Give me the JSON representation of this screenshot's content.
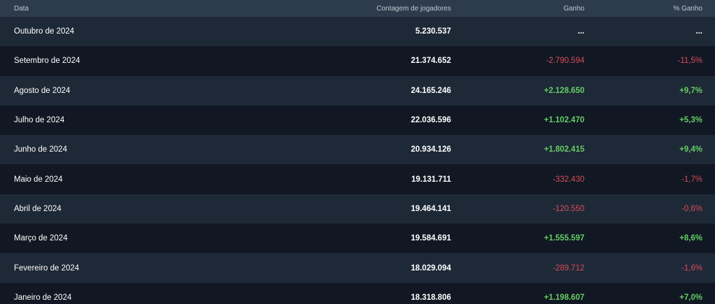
{
  "table": {
    "headers": {
      "date": "Data",
      "count": "Contagem de jogadores",
      "gain": "Ganho",
      "pct": "% Ganho"
    },
    "colors": {
      "header_bg": "#2d3c4d",
      "row_odd": "#1e2937",
      "row_even": "#111823",
      "positive": "#66cc66",
      "negative": "#d94b5a"
    },
    "rows": [
      {
        "date": "Outubro de 2024",
        "count": "5.230.537",
        "gain": "...",
        "pct": "...",
        "trend": "neutral"
      },
      {
        "date": "Setembro de 2024",
        "count": "21.374.652",
        "gain": "-2.790.594",
        "pct": "-11,5%",
        "trend": "neg"
      },
      {
        "date": "Agosto de 2024",
        "count": "24.165.246",
        "gain": "+2.128.650",
        "pct": "+9,7%",
        "trend": "pos"
      },
      {
        "date": "Julho de 2024",
        "count": "22.036.596",
        "gain": "+1.102.470",
        "pct": "+5,3%",
        "trend": "pos"
      },
      {
        "date": "Junho de 2024",
        "count": "20.934.126",
        "gain": "+1.802.415",
        "pct": "+9,4%",
        "trend": "pos"
      },
      {
        "date": "Maio de 2024",
        "count": "19.131.711",
        "gain": "-332.430",
        "pct": "-1,7%",
        "trend": "neg"
      },
      {
        "date": "Abril de 2024",
        "count": "19.464.141",
        "gain": "-120.550",
        "pct": "-0,6%",
        "trend": "neg"
      },
      {
        "date": "Março de 2024",
        "count": "19.584.691",
        "gain": "+1.555.597",
        "pct": "+8,6%",
        "trend": "pos"
      },
      {
        "date": "Fevereiro de 2024",
        "count": "18.029.094",
        "gain": "-289.712",
        "pct": "-1,6%",
        "trend": "neg"
      },
      {
        "date": "Janeiro de 2024",
        "count": "18.318.806",
        "gain": "+1.198.607",
        "pct": "+7,0%",
        "trend": "pos"
      }
    ]
  }
}
